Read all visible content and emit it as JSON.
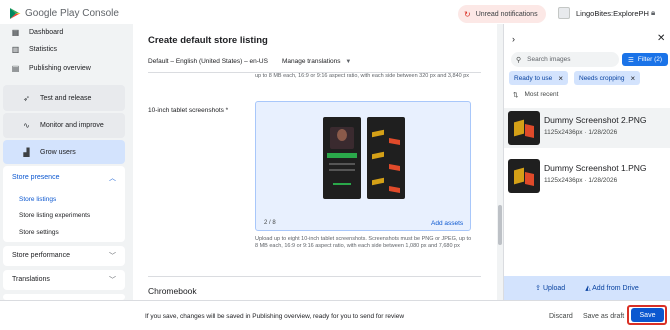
{
  "app": {
    "name": "Google Play Console",
    "notification_label": "Unread notifications",
    "account_name": "LingoBites:ExplorePH"
  },
  "sidebar": {
    "items": [
      {
        "label": "Dashboard",
        "icon": "dashboard-icon"
      },
      {
        "label": "Statistics",
        "icon": "statistics-icon"
      },
      {
        "label": "Publishing overview",
        "icon": "publishing-icon"
      },
      {
        "label": "Test and release",
        "icon": "rocket-icon"
      },
      {
        "label": "Monitor and improve",
        "icon": "monitor-icon"
      },
      {
        "label": "Grow users",
        "icon": "grow-icon"
      }
    ],
    "store_presence": {
      "label": "Store presence",
      "items": [
        "Store listings",
        "Store listing experiments",
        "Store settings"
      ]
    },
    "store_performance": "Store performance",
    "translations": "Translations"
  },
  "main": {
    "title": "Create default store listing",
    "language": "Default – English (United States) – en-US",
    "manage_translations": "Manage translations",
    "help_top": "up to 8 MB each, 16:9 or 9:16 aspect ratio, with each side between 320 px and 3,840 px",
    "field_label": "10-inch tablet screenshots *",
    "count": "2 / 8",
    "add_assets": "Add assets",
    "help_bottom": "Upload up to eight 10-inch tablet screenshots. Screenshots must be PNG or JPEG, up to 8 MB each, 16:9 or 9:16 aspect ratio, with each side between 1,080 px and 7,680 px",
    "next_section": "Chromebook"
  },
  "right_panel": {
    "search_placeholder": "Search images",
    "filter_label": "Filter (2)",
    "chips": [
      "Ready to use",
      "Needs cropping"
    ],
    "sort_label": "Most recent",
    "images": [
      {
        "name": "Dummy Screenshot 2.PNG",
        "meta": "1125x2436px  ·  1/28/2026"
      },
      {
        "name": "Dummy Screenshot 1.PNG",
        "meta": "1125x2436px  ·  1/28/2026"
      }
    ],
    "upload_label": "Upload",
    "drive_label": "Add from Drive"
  },
  "bottom_bar": {
    "message": "If you save, changes will be saved in Publishing overview, ready for you to send for review",
    "discard": "Discard",
    "save_draft": "Save as draft",
    "save": "Save"
  }
}
